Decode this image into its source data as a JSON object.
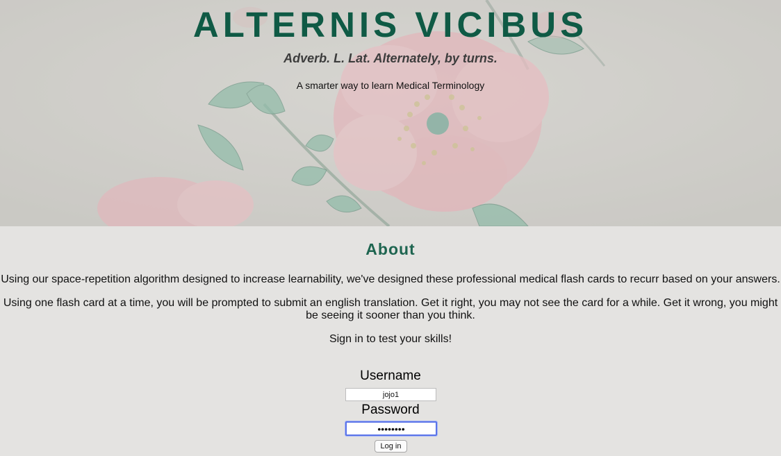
{
  "hero": {
    "title": "ALTERNIS VICIBUS",
    "definition": "Adverb. L. Lat. Alternately, by turns.",
    "tagline": "A smarter way to learn Medical Terminology",
    "background": "botanical rose illustration"
  },
  "about": {
    "heading": "About",
    "paragraph1": "Using our space-repetition algorithm designed to increase learnability, we've designed these professional medical flash cards to recurr based on your answers.",
    "paragraph2": "Using one flash card at a time, you will be prompted to submit an english translation. Get it right, you may not see the card for a while. Get it wrong, you might be seeing it sooner than you think.",
    "paragraph3": "Sign in to test your skills!"
  },
  "login": {
    "username_label": "Username",
    "username_value": "jojo1",
    "password_label": "Password",
    "password_value": "jojo1234",
    "submit_label": "Log in"
  },
  "colors": {
    "title_green": "#0f5a45",
    "heading_green": "#1e6550",
    "page_bg": "#e4e3e1",
    "focus_ring": "#5b74e8"
  }
}
